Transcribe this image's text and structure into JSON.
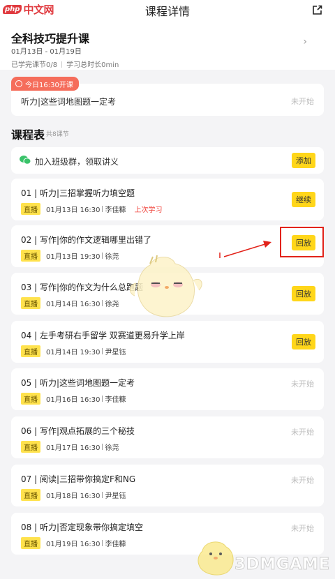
{
  "brand": {
    "php": "php",
    "cn": "中文网"
  },
  "header": {
    "title": "课程详情"
  },
  "course": {
    "title": "全科技巧提升课",
    "dates": "01月13日 - 01月19日",
    "completed": "已学完课节0/8",
    "duration": "学习总时长0min"
  },
  "today": {
    "badge": "今日16:30开课",
    "lesson": "听力|这些词地图题一定考",
    "status": "未开始"
  },
  "schedule": {
    "title": "课程表",
    "count": "共8课节"
  },
  "wechat": {
    "label": "加入班级群，领取讲义",
    "button": "添加"
  },
  "live_tag": "直播",
  "lessons": [
    {
      "name": "01 | 听力|三招掌握听力填空题",
      "time": "01月13日 16:30",
      "teacher": "李佳糠",
      "note": "上次学习",
      "action": "继续"
    },
    {
      "name": "02 | 写作|你的作文逻辑哪里出错了",
      "time": "01月13日 19:30",
      "teacher": "徐尧",
      "action": "回放"
    },
    {
      "name": "03 | 写作|你的作文为什么总跑题",
      "time": "01月14日 16:30",
      "teacher": "徐尧",
      "action": "回放"
    },
    {
      "name": "04 | 左手考研右手留学 双赛道更易升学上岸",
      "time": "01月14日 19:30",
      "teacher": "尹星钰",
      "action": "回放"
    },
    {
      "name": "05 | 听力|这些词地图题一定考",
      "time": "01月16日 16:30",
      "teacher": "李佳糠",
      "status": "未开始"
    },
    {
      "name": "06 | 写作|观点拓展的三个秘技",
      "time": "01月17日 16:30",
      "teacher": "徐尧",
      "status": "未开始"
    },
    {
      "name": "07 | 阅读|三招带你搞定F和NG",
      "time": "01月18日 16:30",
      "teacher": "尹星钰",
      "status": "未开始"
    },
    {
      "name": "08 | 听力|否定现象带你搞定填空",
      "time": "01月19日 16:30",
      "teacher": "李佳糠",
      "status": "未开始"
    }
  ],
  "watermark": "3DMGAME",
  "colors": {
    "accent": "#ffd61a",
    "badge": "#f56d5b",
    "alert": "#e2231a",
    "bg": "#f4f4f6"
  }
}
